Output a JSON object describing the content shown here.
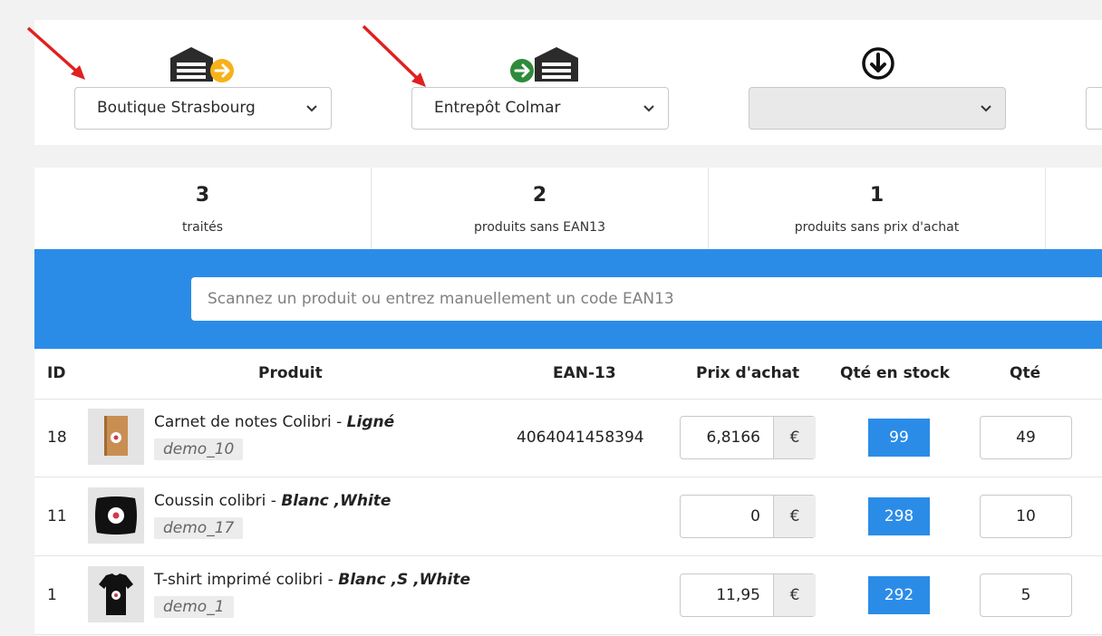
{
  "locations": {
    "source": {
      "icon": "warehouse-out-icon",
      "selected": "Boutique Strasbourg"
    },
    "destination": {
      "icon": "warehouse-in-icon",
      "selected": "Entrepôt Colmar"
    },
    "third": {
      "icon": "download-circle-icon",
      "selected": ""
    }
  },
  "stats": [
    {
      "value": "3",
      "label": "traités"
    },
    {
      "value": "2",
      "label": "produits sans EAN13"
    },
    {
      "value": "1",
      "label": "produits sans prix d'achat"
    }
  ],
  "scan": {
    "placeholder": "Scannez un produit ou entrez manuellement un code EAN13"
  },
  "table": {
    "headers": {
      "id": "ID",
      "product": "Produit",
      "ean": "EAN-13",
      "price": "Prix d'achat",
      "stock": "Qté en stock",
      "qty": "Qté"
    },
    "currency": "€",
    "rows": [
      {
        "id": "18",
        "name": "Carnet de notes Colibri",
        "sep": " - ",
        "variant": "Ligné",
        "ref": "demo_10",
        "ean": "4064041458394",
        "price": "6,8166",
        "stock": "99",
        "qty": "49",
        "thumb": "notebook-thumbnail"
      },
      {
        "id": "11",
        "name": "Coussin colibri",
        "sep": " - ",
        "variant": "Blanc ,White",
        "ref": "demo_17",
        "ean": "",
        "price": "0",
        "stock": "298",
        "qty": "10",
        "thumb": "cushion-thumbnail"
      },
      {
        "id": "1",
        "name": "T-shirt imprimé colibri",
        "sep": " - ",
        "variant": "Blanc ,S ,White",
        "ref": "demo_1",
        "ean": "",
        "price": "11,95",
        "stock": "292",
        "qty": "5",
        "thumb": "tshirt-thumbnail"
      }
    ]
  },
  "colors": {
    "accent": "#2b8ce8",
    "arrow": "#e02020",
    "in_icon": "#2e8b3a",
    "out_icon": "#f5b21a"
  }
}
